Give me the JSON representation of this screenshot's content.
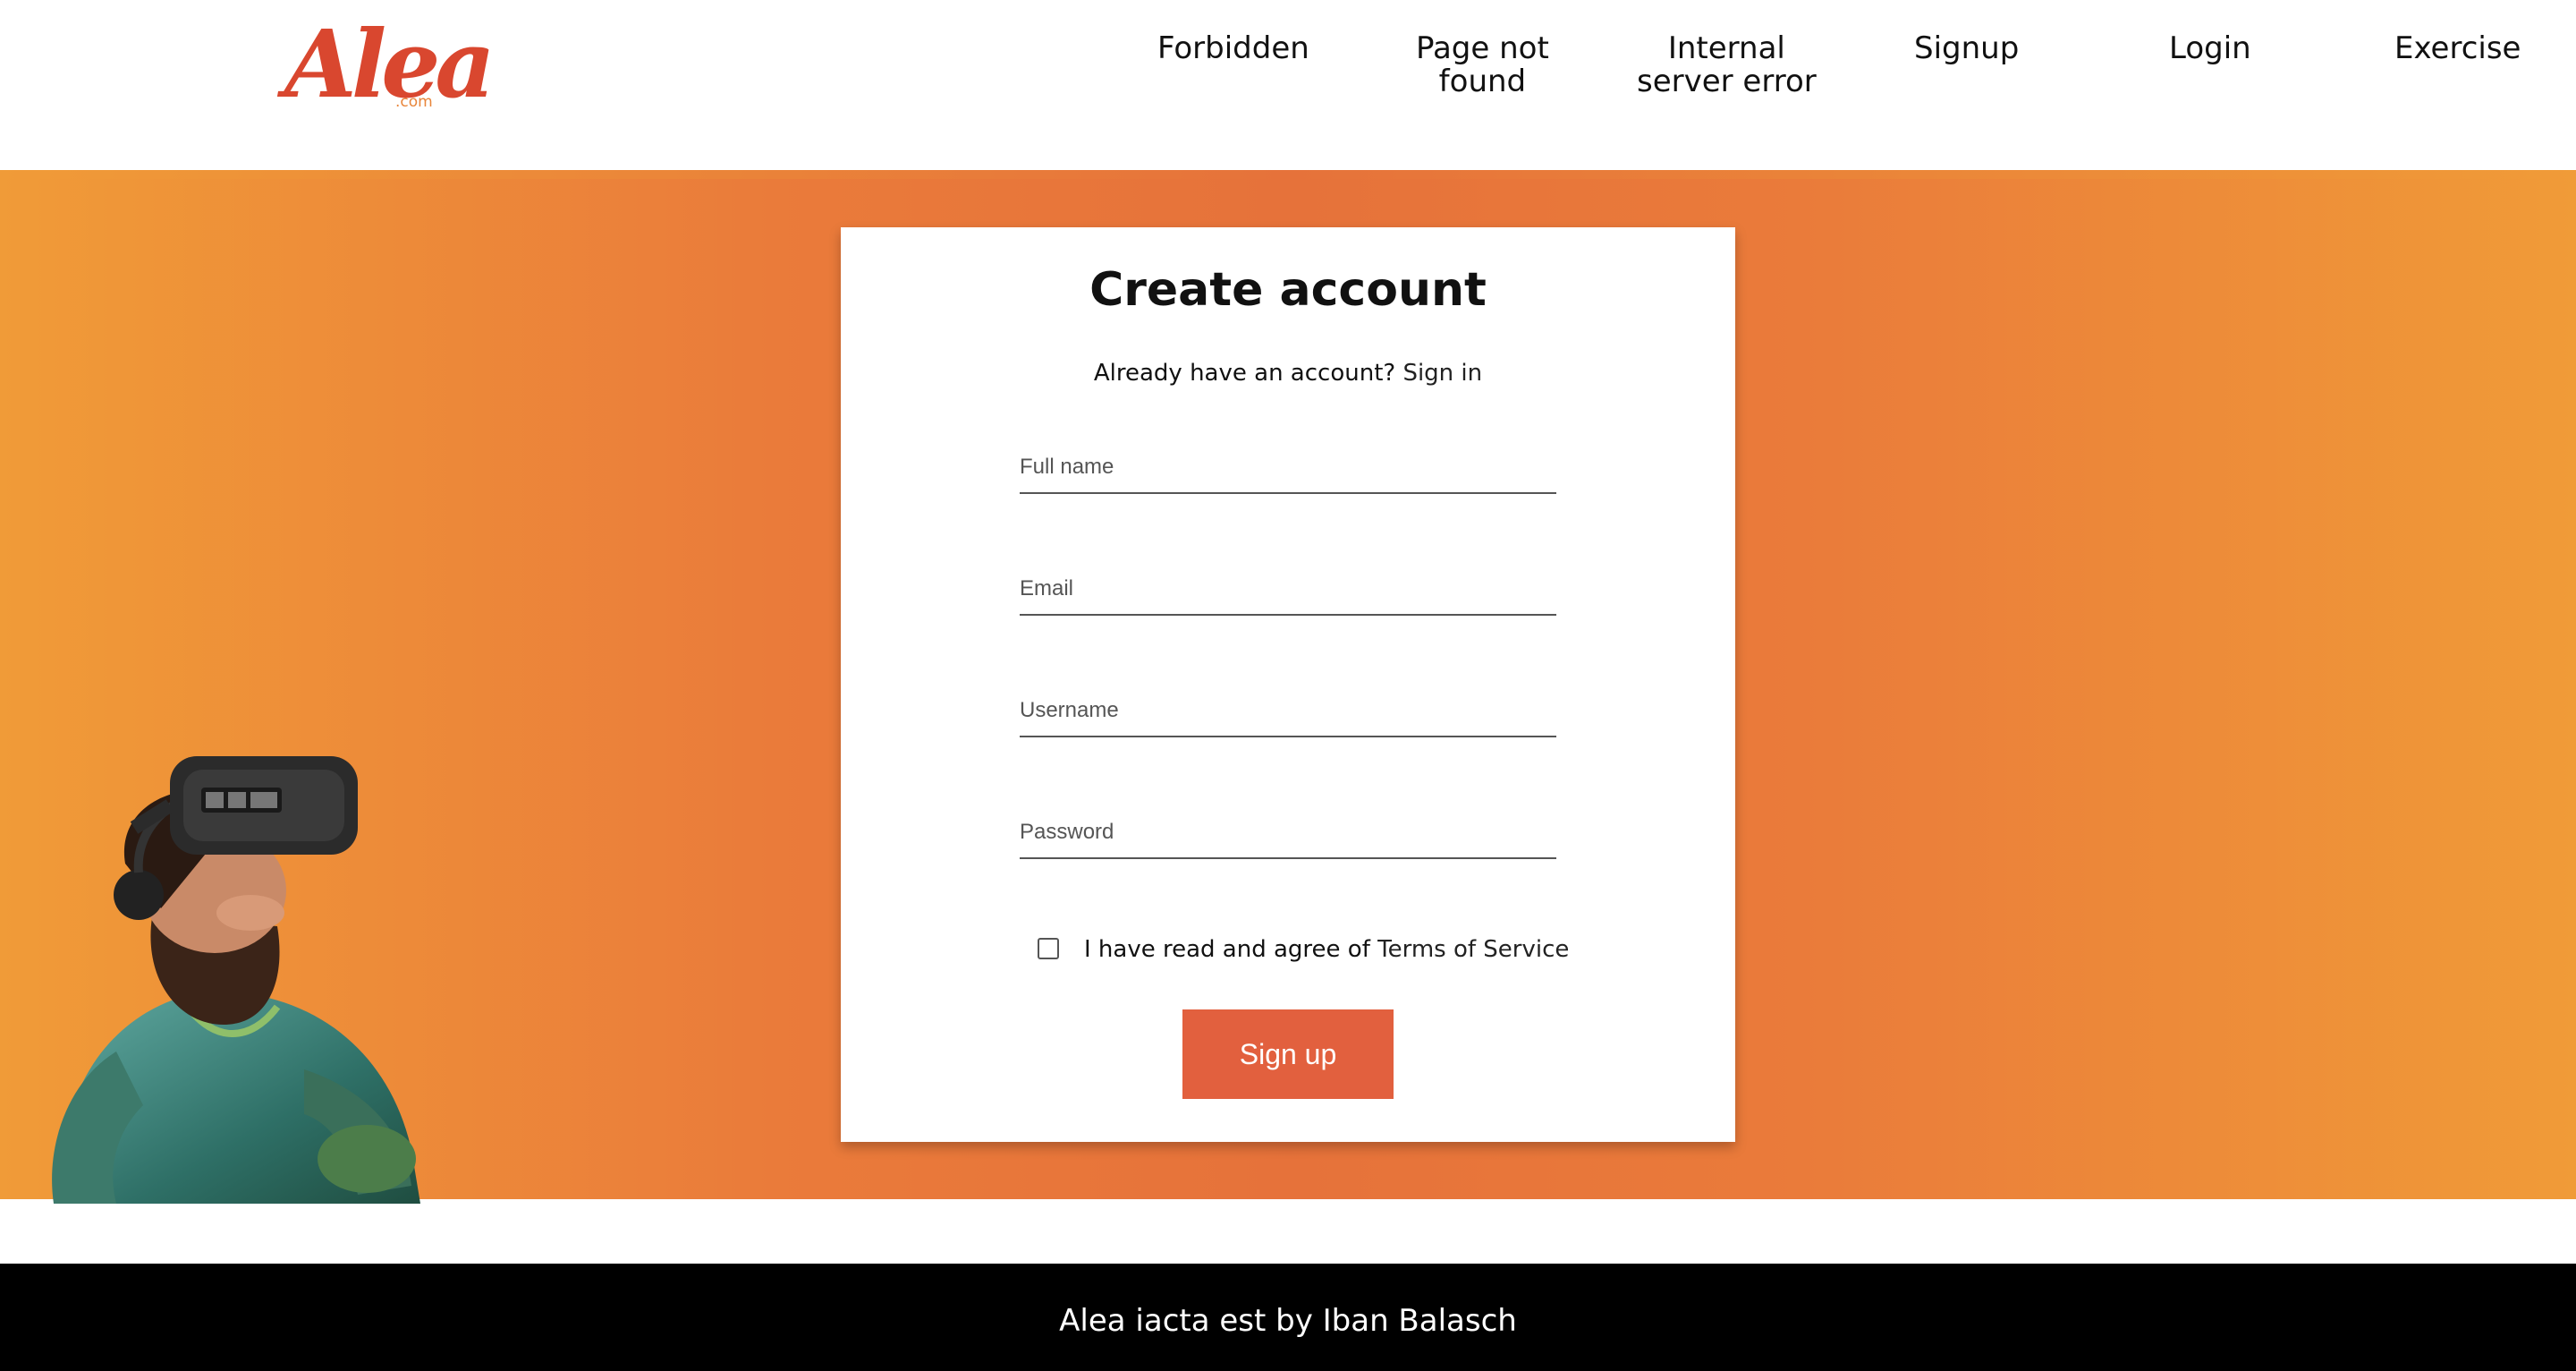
{
  "brand": {
    "logo_text": "Alea",
    "logo_sub": ".com"
  },
  "nav": {
    "items": [
      {
        "label": "Forbidden"
      },
      {
        "label": "Page not\nfound"
      },
      {
        "label": "Internal\nserver error"
      },
      {
        "label": "Signup"
      },
      {
        "label": "Login"
      },
      {
        "label": "Exercise"
      }
    ]
  },
  "form": {
    "title": "Create account",
    "already_prefix": "Already have an account?",
    "sign_in_link": "Sign in",
    "fields": {
      "full_name_placeholder": "Full name",
      "email_placeholder": "Email",
      "username_placeholder": "Username",
      "password_placeholder": "Password"
    },
    "terms_prefix": "I have read and agree of",
    "terms_link": "Terms of Service",
    "submit_label": "Sign up"
  },
  "footer": {
    "text": "Alea iacta est by Iban Balasch"
  },
  "colors": {
    "accent": "#e2603e",
    "logo": "#d9472f",
    "band_edge": "#f09b38",
    "band_center": "#e6723a"
  }
}
